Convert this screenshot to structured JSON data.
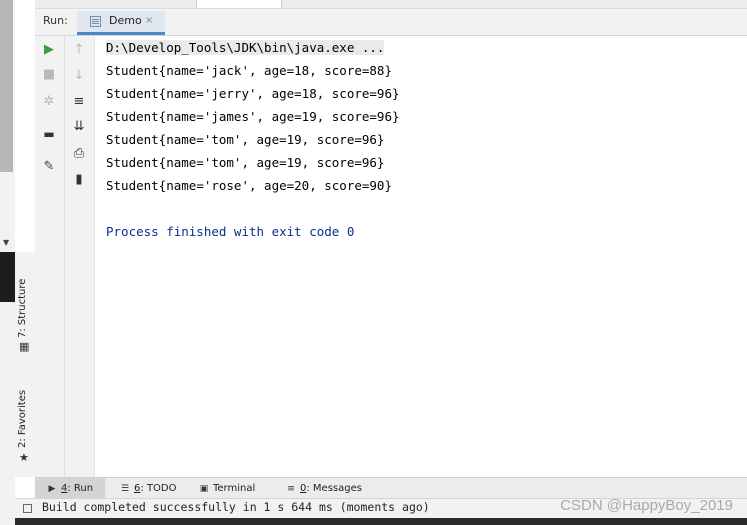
{
  "run_panel": {
    "title": "Run:",
    "tab_label": "Demo",
    "tab_close": "×"
  },
  "console": {
    "command_line": "D:\\Develop_Tools\\JDK\\bin\\java.exe ...",
    "output_lines": [
      "Student{name='jack', age=18, score=88}",
      "Student{name='jerry', age=18, score=96}",
      "Student{name='james', age=19, score=96}",
      "Student{name='tom', age=19, score=96}",
      "Student{name='tom', age=19, score=96}",
      "Student{name='rose', age=20, score=90}"
    ],
    "exit_message": "Process finished with exit code 0"
  },
  "side_bar": {
    "structure_label": "7: Structure",
    "favorites_label": "2: Favorites"
  },
  "bottom_tabs": [
    {
      "key": "4",
      "label": ": Run"
    },
    {
      "key": "6",
      "label": ": TODO"
    },
    {
      "key": "",
      "label": "Terminal"
    },
    {
      "key": "0",
      "label": ": Messages"
    }
  ],
  "status": {
    "text": "Build completed successfully in 1 s 644 ms (moments ago)"
  },
  "watermark": "CSDN @HappyBoy_2019",
  "colors": {
    "accent": "#4a88c7",
    "run_green": "#3f9a3f",
    "process_blue": "#0b2f8c"
  },
  "icons": {
    "rerun": "play-icon",
    "stop": "stop-icon",
    "scroll_up": "arrow-up-icon",
    "scroll_down": "arrow-down-icon",
    "soft_wrap": "soft-wrap-icon",
    "scroll_to_end": "scroll-to-end-icon",
    "print": "print-icon",
    "clear": "trash-icon",
    "pin": "pin-icon",
    "layout": "layout-icon",
    "settings": "settings-icon"
  }
}
